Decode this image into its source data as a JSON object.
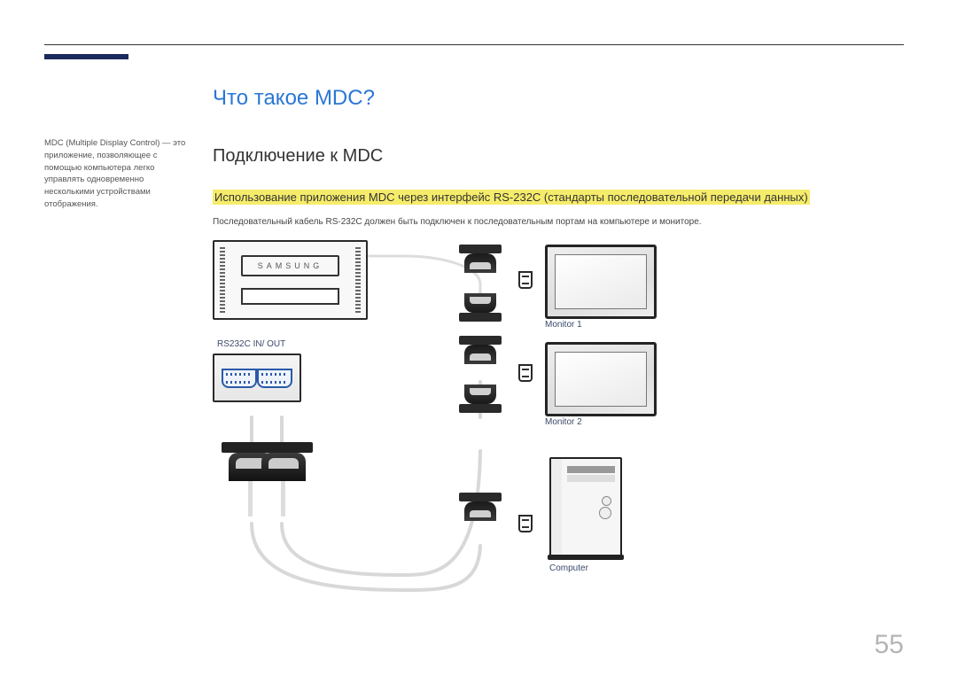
{
  "sidebar": {
    "note": "MDC (Multiple Display Control) — это приложение, позволяющее с помощью компьютера легко управлять одновременно несколькими устройствами отображения."
  },
  "main": {
    "title": "Что такое MDC?",
    "subtitle": "Подключение к MDC",
    "highlighted": "Использование приложения MDC через интерфейс RS-232C (стандарты последовательной передачи данных)",
    "body": "Последовательный кабель RS-232C должен быть подключен к последовательным портам на компьютере и мониторе."
  },
  "diagram": {
    "device_logo": "SAMSUNG",
    "port_label": "RS232C IN/ OUT",
    "monitor1": "Monitor 1",
    "monitor2": "Monitor 2",
    "computer": "Computer"
  },
  "page_number": "55"
}
